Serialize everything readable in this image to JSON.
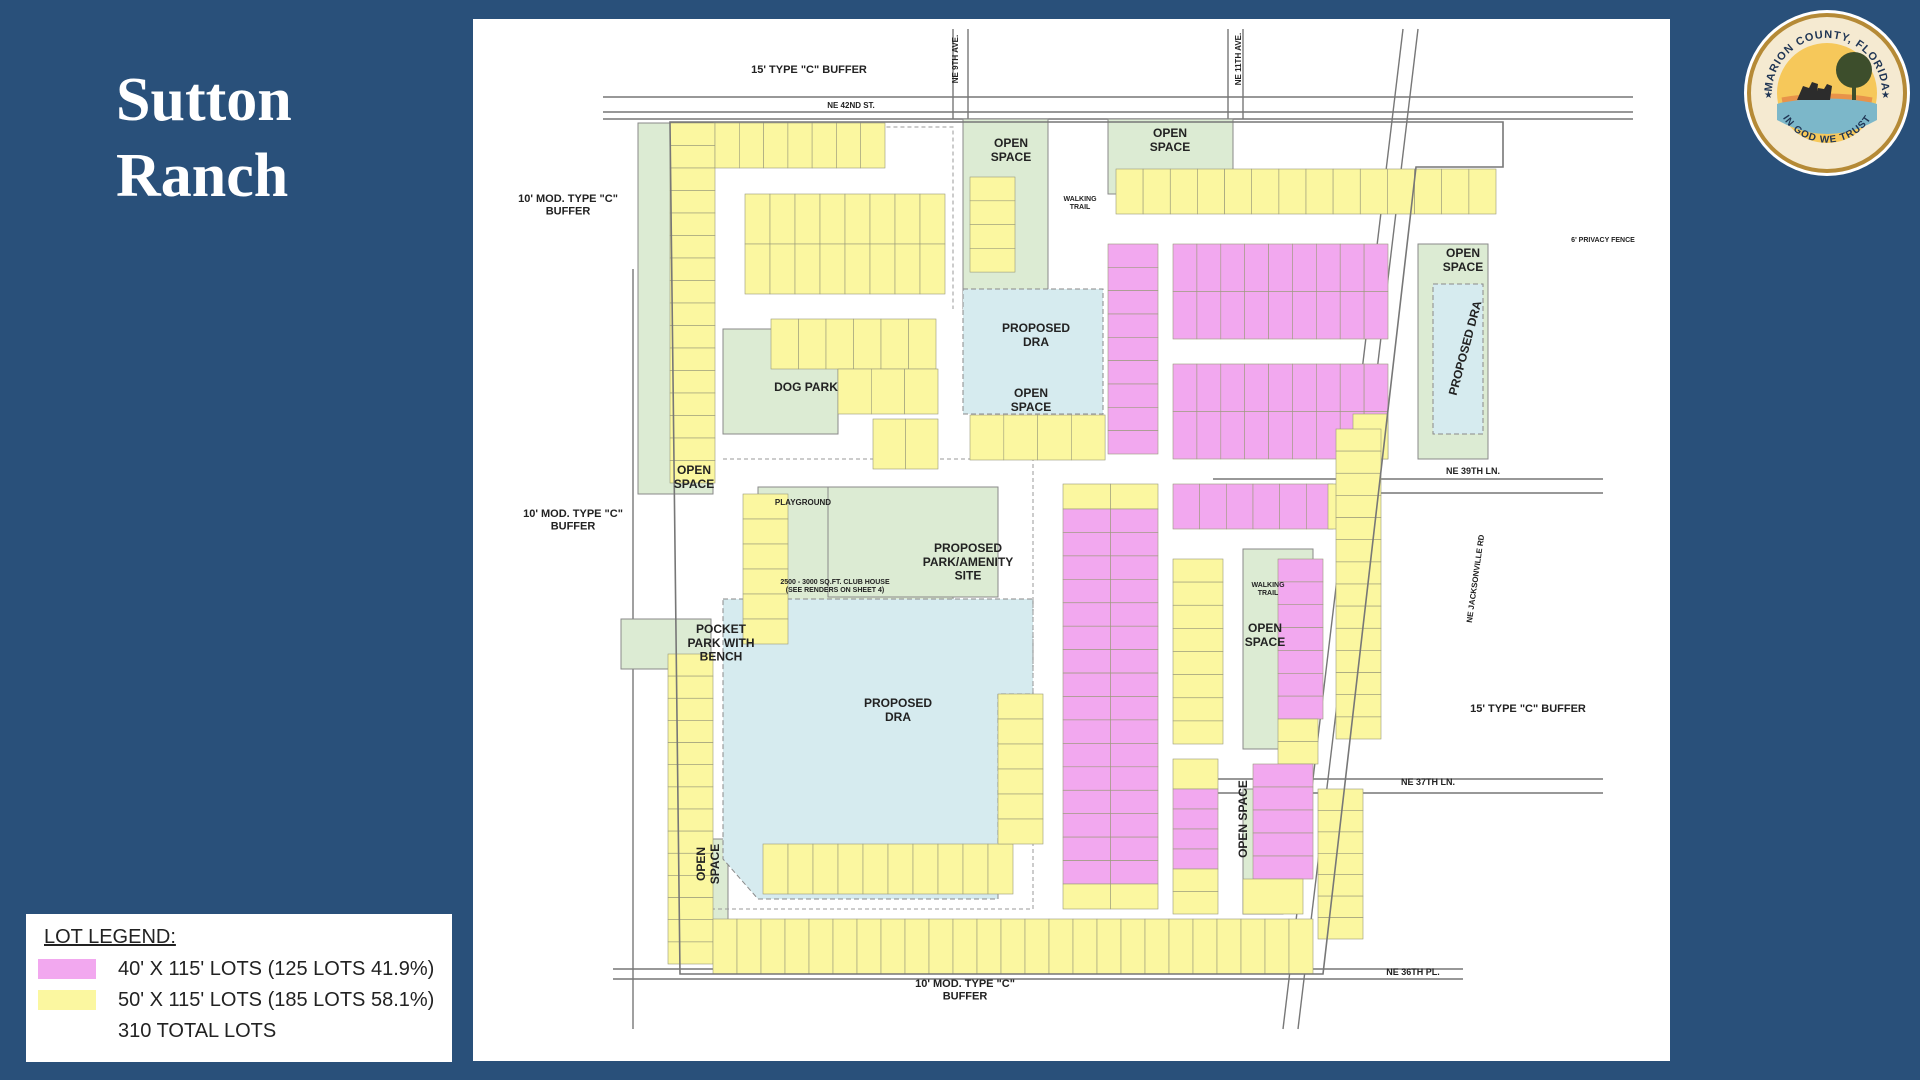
{
  "title": {
    "line1": "Sutton",
    "line2": "Ranch"
  },
  "seal": {
    "top_text": "MARION COUNTY, FLORIDA",
    "bottom_text": "IN GOD WE TRUST",
    "icon": "marion-county-seal-icon"
  },
  "legend": {
    "title": "LOT LEGEND:",
    "items": [
      {
        "label": "40' X 115' LOTS (125 LOTS 41.9%)",
        "color": "#f2a8ef"
      },
      {
        "label": "50' X 115' LOTS (185 LOTS 58.1%)",
        "color": "#fbf7a0"
      },
      {
        "label": "310 TOTAL LOTS",
        "color": ""
      }
    ]
  },
  "plan": {
    "colors": {
      "pink_lot": "#f2a8ef",
      "yellow_lot": "#fbf7a0",
      "open_space": "#dcebd3",
      "dra_water": "#d6ebef",
      "road": "#ffffff",
      "line": "#777777"
    },
    "labels": {
      "buffer_top": "15' TYPE \"C\" BUFFER",
      "buffer_left_top": "10' MOD. TYPE \"C\"\nBUFFER",
      "buffer_left_mid": "10' MOD. TYPE \"C\"\nBUFFER",
      "buffer_right": "15' TYPE \"C\" BUFFER",
      "buffer_bottom": "10' MOD. TYPE \"C\"\nBUFFER",
      "street_42nd": "NE 42ND ST.",
      "street_9th_ave": "NE 9TH AVE.",
      "street_11th_ave": "NE 11TH AVE.",
      "street_39th_ln": "NE 39TH LN.",
      "street_37th_ln": "NE 37TH LN.",
      "street_36th_pl": "NE 36TH PL.",
      "street_jacksonville": "NE JACKSONVILLE RD",
      "open_space": "OPEN\nSPACE",
      "open_space_single": "OPEN SPACE",
      "proposed_dra": "PROPOSED\nDRA",
      "proposed_dra_single": "PROPOSED DRA",
      "dog_park": "DOG PARK",
      "playground": "PLAYGROUND",
      "amenity": "PROPOSED\nPARK/AMENITY\nSITE",
      "clubhouse": "2500 - 3000 SQ.FT. CLUB HOUSE\n(SEE RENDERS ON SHEET 4)",
      "pocket_park": "POCKET\nPARK WITH\nBENCH",
      "walking_trail": "WALKING\nTRAIL",
      "privacy_fence": "6' PRIVACY FENCE"
    }
  }
}
